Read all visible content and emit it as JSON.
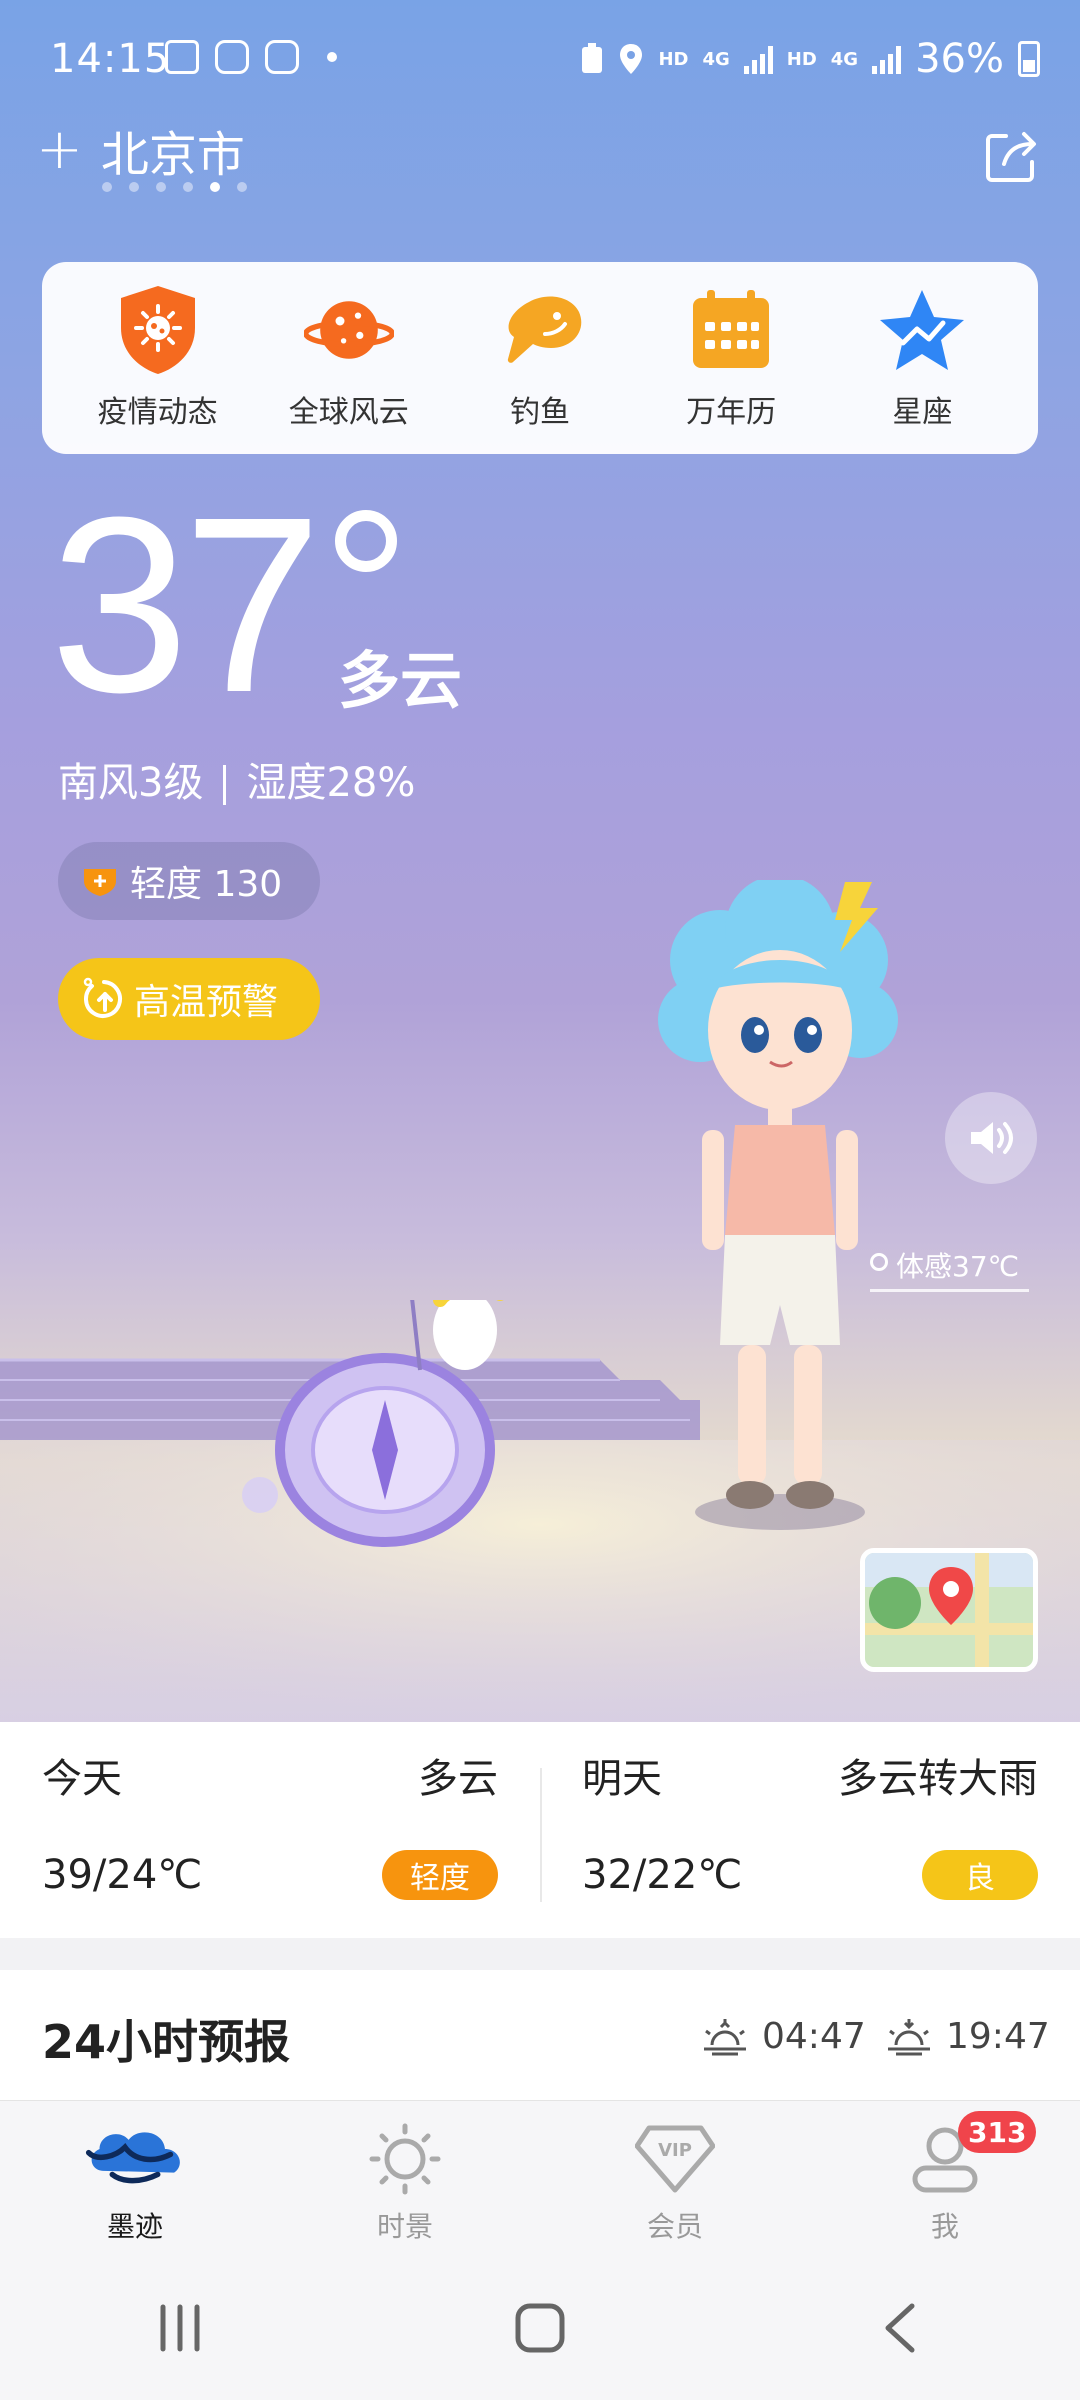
{
  "status_bar": {
    "time": "14:15",
    "network_hd_1": "HD",
    "network_4g_1": "4G",
    "network_hd_2": "HD",
    "network_4g_2": "4G",
    "battery": "36%"
  },
  "header": {
    "add_symbol": "+",
    "city": "北京市",
    "page_count": 6,
    "active_page_index": 4
  },
  "shortcuts": [
    {
      "label": "疫情动态",
      "icon": "epidemic-shield-icon",
      "color": "#f56a1f"
    },
    {
      "label": "全球风云",
      "icon": "planet-icon",
      "color": "#f56a1f"
    },
    {
      "label": "钓鱼",
      "icon": "fish-icon",
      "color": "#f5a623"
    },
    {
      "label": "万年历",
      "icon": "calendar-icon",
      "color": "#f5a623"
    },
    {
      "label": "星座",
      "icon": "star-icon",
      "color": "#2f86f5"
    }
  ],
  "current": {
    "temperature": "37",
    "condition": "多云",
    "wind": "南风3级",
    "humidity": "湿度28%",
    "aqi_label": "轻度 130",
    "alert_label": "高温预警",
    "feels_like": "体感37℃"
  },
  "forecast": [
    {
      "day": "今天",
      "condition": "多云",
      "temp": "39/24℃",
      "aqi": "轻度",
      "aqi_color": "#f7940e"
    },
    {
      "day": "明天",
      "condition": "多云转大雨",
      "temp": "32/22℃",
      "aqi": "良",
      "aqi_color": "#f5c518"
    }
  ],
  "hourly": {
    "title": "24小时预报",
    "sunrise": "04:47",
    "sunset": "19:47"
  },
  "tabs": [
    {
      "label": "墨迹",
      "icon": "moji-cloud-icon",
      "active": true
    },
    {
      "label": "时景",
      "icon": "sun-outline-icon",
      "active": false
    },
    {
      "label": "会员",
      "icon": "vip-icon",
      "active": false
    },
    {
      "label": "我",
      "icon": "profile-icon",
      "active": false,
      "badge": "313"
    }
  ],
  "colors": {
    "accent_yellow": "#f5c518",
    "accent_orange": "#f7940e",
    "badge_red": "#f0444b"
  }
}
